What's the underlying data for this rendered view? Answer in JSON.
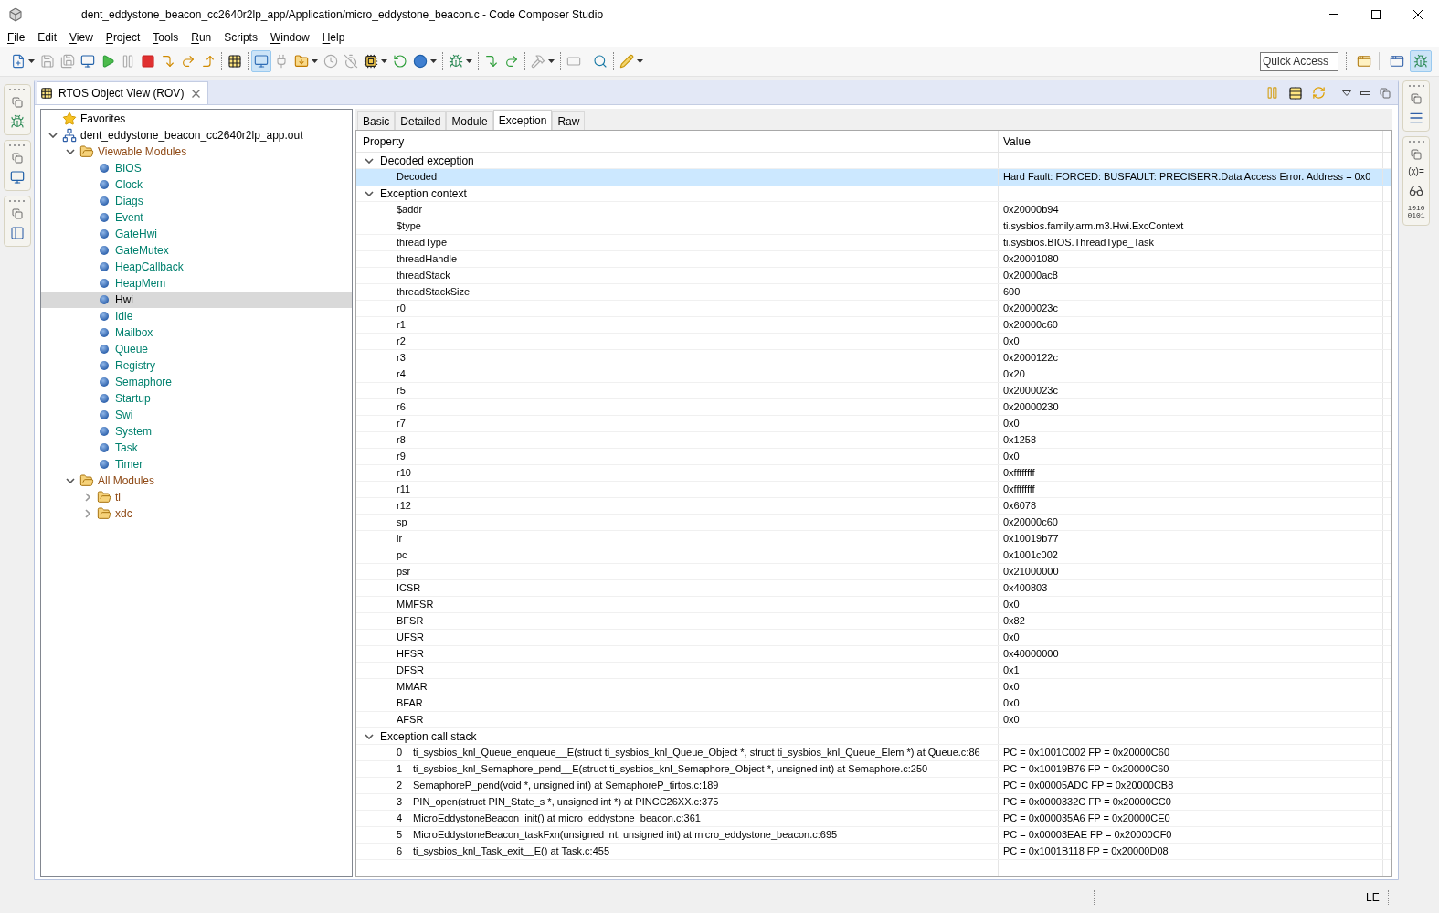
{
  "window": {
    "title": "dent_eddystone_beacon_cc2640r2lp_app/Application/micro_eddystone_beacon.c - Code Composer Studio"
  },
  "menu": [
    {
      "label": "File",
      "mnemonic": true
    },
    {
      "label": "Edit",
      "mnemonic": false
    },
    {
      "label": "View",
      "mnemonic": true
    },
    {
      "label": "Project",
      "mnemonic": true
    },
    {
      "label": "Tools",
      "mnemonic": true
    },
    {
      "label": "Run",
      "mnemonic": true
    },
    {
      "label": "Scripts",
      "mnemonic": false
    },
    {
      "label": "Window",
      "mnemonic": true
    },
    {
      "label": "Help",
      "mnemonic": true
    }
  ],
  "toolbar": [
    {
      "kind": "grip"
    },
    {
      "kind": "new",
      "dropdown": true,
      "disabled": false,
      "pressed": false
    },
    {
      "kind": "save",
      "dropdown": false,
      "disabled": true,
      "pressed": false
    },
    {
      "kind": "save-all",
      "dropdown": false,
      "disabled": true,
      "pressed": false
    },
    {
      "kind": "debug-view",
      "dropdown": false,
      "disabled": false,
      "pressed": false
    },
    {
      "kind": "resume",
      "dropdown": false,
      "disabled": false,
      "pressed": false
    },
    {
      "kind": "suspend",
      "dropdown": false,
      "disabled": true,
      "pressed": false
    },
    {
      "kind": "terminate",
      "dropdown": false,
      "disabled": false,
      "pressed": false
    },
    {
      "kind": "step-into",
      "dropdown": false,
      "disabled": false,
      "pressed": false
    },
    {
      "kind": "step-over",
      "dropdown": false,
      "disabled": false,
      "pressed": false
    },
    {
      "kind": "step-return",
      "dropdown": false,
      "disabled": false,
      "pressed": false
    },
    {
      "kind": "separator"
    },
    {
      "kind": "grid",
      "dropdown": false,
      "disabled": false,
      "pressed": false
    },
    {
      "kind": "separator"
    },
    {
      "kind": "target",
      "dropdown": false,
      "disabled": false,
      "pressed": true
    },
    {
      "kind": "connect",
      "dropdown": false,
      "disabled": true,
      "pressed": false
    },
    {
      "kind": "load",
      "dropdown": true,
      "disabled": false,
      "pressed": false
    },
    {
      "kind": "clock",
      "dropdown": false,
      "disabled": true,
      "pressed": false
    },
    {
      "kind": "clock-off",
      "dropdown": false,
      "disabled": true,
      "pressed": false
    },
    {
      "kind": "chip",
      "dropdown": true,
      "disabled": false,
      "pressed": false
    },
    {
      "kind": "restart",
      "dropdown": false,
      "disabled": false,
      "pressed": false
    },
    {
      "kind": "sphere",
      "dropdown": true,
      "disabled": false,
      "pressed": false
    },
    {
      "kind": "separator"
    },
    {
      "kind": "bug",
      "dropdown": true,
      "disabled": false,
      "pressed": false
    },
    {
      "kind": "separator"
    },
    {
      "kind": "asm-step-into",
      "dropdown": false,
      "disabled": false,
      "pressed": false
    },
    {
      "kind": "asm-step-over",
      "dropdown": false,
      "disabled": false,
      "pressed": false
    },
    {
      "kind": "separator"
    },
    {
      "kind": "hammer",
      "dropdown": true,
      "disabled": true,
      "pressed": false
    },
    {
      "kind": "separator"
    },
    {
      "kind": "frame",
      "dropdown": false,
      "disabled": true,
      "pressed": false
    },
    {
      "kind": "separator"
    },
    {
      "kind": "search",
      "dropdown": false,
      "disabled": false,
      "pressed": false
    },
    {
      "kind": "separator"
    },
    {
      "kind": "pen",
      "dropdown": true,
      "disabled": false,
      "pressed": false
    }
  ],
  "quick_access": {
    "placeholder": "Quick Access"
  },
  "perspectives": [
    {
      "kind": "edit",
      "selected": false
    },
    {
      "kind": "debug",
      "selected": true
    }
  ],
  "view": {
    "title": "RTOS Object View (ROV)"
  },
  "tree": [
    {
      "label": "Favorites",
      "kind": "favorites",
      "selected": false
    },
    {
      "label": "dent_eddystone_beacon_cc2640r2lp_app.out",
      "kind": "program",
      "selected": false,
      "expanded": true,
      "children": [
        {
          "label": "Viewable Modules",
          "kind": "folder",
          "selected": false,
          "expanded": true,
          "children": [
            {
              "label": "BIOS",
              "kind": "module",
              "selected": false
            },
            {
              "label": "Clock",
              "kind": "module",
              "selected": false
            },
            {
              "label": "Diags",
              "kind": "module",
              "selected": false
            },
            {
              "label": "Event",
              "kind": "module",
              "selected": false
            },
            {
              "label": "GateHwi",
              "kind": "module",
              "selected": false
            },
            {
              "label": "GateMutex",
              "kind": "module",
              "selected": false
            },
            {
              "label": "HeapCallback",
              "kind": "module",
              "selected": false
            },
            {
              "label": "HeapMem",
              "kind": "module",
              "selected": false
            },
            {
              "label": "Hwi",
              "kind": "module",
              "selected": true
            },
            {
              "label": "Idle",
              "kind": "module",
              "selected": false
            },
            {
              "label": "Mailbox",
              "kind": "module",
              "selected": false
            },
            {
              "label": "Queue",
              "kind": "module",
              "selected": false
            },
            {
              "label": "Registry",
              "kind": "module",
              "selected": false
            },
            {
              "label": "Semaphore",
              "kind": "module",
              "selected": false
            },
            {
              "label": "Startup",
              "kind": "module",
              "selected": false
            },
            {
              "label": "Swi",
              "kind": "module",
              "selected": false
            },
            {
              "label": "System",
              "kind": "module",
              "selected": false
            },
            {
              "label": "Task",
              "kind": "module",
              "selected": false
            },
            {
              "label": "Timer",
              "kind": "module",
              "selected": false
            }
          ]
        },
        {
          "label": "All Modules",
          "kind": "folder",
          "selected": false,
          "expanded": true,
          "children": [
            {
              "label": "ti",
              "kind": "folder",
              "selected": false,
              "expanded": false
            },
            {
              "label": "xdc",
              "kind": "folder",
              "selected": false,
              "expanded": false
            }
          ]
        }
      ]
    }
  ],
  "tabs": [
    {
      "label": "Basic",
      "selected": false
    },
    {
      "label": "Detailed",
      "selected": false
    },
    {
      "label": "Module",
      "selected": false
    },
    {
      "label": "Exception",
      "selected": true
    },
    {
      "label": "Raw",
      "selected": false
    }
  ],
  "table": {
    "columns": [
      "Property",
      "Value"
    ],
    "groups": [
      {
        "label": "Decoded exception",
        "expanded": true,
        "rows": [
          {
            "property": "Decoded",
            "value": "Hard Fault: FORCED: BUSFAULT: PRECISERR.Data Access Error. Address = 0x0",
            "selected": true
          }
        ]
      },
      {
        "label": "Exception context",
        "expanded": true,
        "rows": [
          {
            "property": "$addr",
            "value": "0x20000b94",
            "selected": false
          },
          {
            "property": "$type",
            "value": "ti.sysbios.family.arm.m3.Hwi.ExcContext",
            "selected": false
          },
          {
            "property": "threadType",
            "value": "ti.sysbios.BIOS.ThreadType_Task",
            "selected": false
          },
          {
            "property": "threadHandle",
            "value": "0x20001080",
            "selected": false
          },
          {
            "property": "threadStack",
            "value": "0x20000ac8",
            "selected": false
          },
          {
            "property": "threadStackSize",
            "value": "600",
            "selected": false
          },
          {
            "property": "r0",
            "value": "0x2000023c",
            "selected": false
          },
          {
            "property": "r1",
            "value": "0x20000c60",
            "selected": false
          },
          {
            "property": "r2",
            "value": "0x0",
            "selected": false
          },
          {
            "property": "r3",
            "value": "0x2000122c",
            "selected": false
          },
          {
            "property": "r4",
            "value": "0x20",
            "selected": false
          },
          {
            "property": "r5",
            "value": "0x2000023c",
            "selected": false
          },
          {
            "property": "r6",
            "value": "0x20000230",
            "selected": false
          },
          {
            "property": "r7",
            "value": "0x0",
            "selected": false
          },
          {
            "property": "r8",
            "value": "0x1258",
            "selected": false
          },
          {
            "property": "r9",
            "value": "0x0",
            "selected": false
          },
          {
            "property": "r10",
            "value": "0xffffffff",
            "selected": false
          },
          {
            "property": "r11",
            "value": "0xffffffff",
            "selected": false
          },
          {
            "property": "r12",
            "value": "0x6078",
            "selected": false
          },
          {
            "property": "sp",
            "value": "0x20000c60",
            "selected": false
          },
          {
            "property": "lr",
            "value": "0x10019b77",
            "selected": false
          },
          {
            "property": "pc",
            "value": "0x1001c002",
            "selected": false
          },
          {
            "property": "psr",
            "value": "0x21000000",
            "selected": false
          },
          {
            "property": "ICSR",
            "value": "0x400803",
            "selected": false
          },
          {
            "property": "MMFSR",
            "value": "0x0",
            "selected": false
          },
          {
            "property": "BFSR",
            "value": "0x82",
            "selected": false
          },
          {
            "property": "UFSR",
            "value": "0x0",
            "selected": false
          },
          {
            "property": "HFSR",
            "value": "0x40000000",
            "selected": false
          },
          {
            "property": "DFSR",
            "value": "0x1",
            "selected": false
          },
          {
            "property": "MMAR",
            "value": "0x0",
            "selected": false
          },
          {
            "property": "BFAR",
            "value": "0x0",
            "selected": false
          },
          {
            "property": "AFSR",
            "value": "0x0",
            "selected": false
          }
        ]
      },
      {
        "label": "Exception call stack",
        "expanded": true,
        "rows": [
          {
            "index": "0",
            "property": "ti_sysbios_knl_Queue_enqueue__E(struct ti_sysbios_knl_Queue_Object *, struct ti_sysbios_knl_Queue_Elem *) at Queue.c:86",
            "value": "PC = 0x1001C002 FP = 0x20000C60",
            "selected": false
          },
          {
            "index": "1",
            "property": "ti_sysbios_knl_Semaphore_pend__E(struct ti_sysbios_knl_Semaphore_Object *, unsigned int) at Semaphore.c:250",
            "value": "PC = 0x10019B76 FP = 0x20000C60",
            "selected": false
          },
          {
            "index": "2",
            "property": "SemaphoreP_pend(void *, unsigned int) at SemaphoreP_tirtos.c:189",
            "value": "PC = 0x00005ADC FP = 0x20000CB8",
            "selected": false
          },
          {
            "index": "3",
            "property": "PIN_open(struct PIN_State_s *, unsigned int *) at PINCC26XX.c:375",
            "value": "PC = 0x0000332C FP = 0x20000CC0",
            "selected": false
          },
          {
            "index": "4",
            "property": "MicroEddystoneBeacon_init() at micro_eddystone_beacon.c:361",
            "value": "PC = 0x000035A6 FP = 0x20000CE0",
            "selected": false
          },
          {
            "index": "5",
            "property": "MicroEddystoneBeacon_taskFxn(unsigned int, unsigned int) at micro_eddystone_beacon.c:695",
            "value": "PC = 0x00003EAE FP = 0x20000CF0",
            "selected": false
          },
          {
            "index": "6",
            "property": "ti_sysbios_knl_Task_exit__E() at Task.c:455",
            "value": "PC = 0x1001B118 FP = 0x20000D08",
            "selected": false
          }
        ]
      }
    ]
  },
  "right_trim": {
    "variables_glyph": "(x)=",
    "registers_glyph": "1010 0101"
  },
  "status_bar": {
    "text": "LE"
  }
}
